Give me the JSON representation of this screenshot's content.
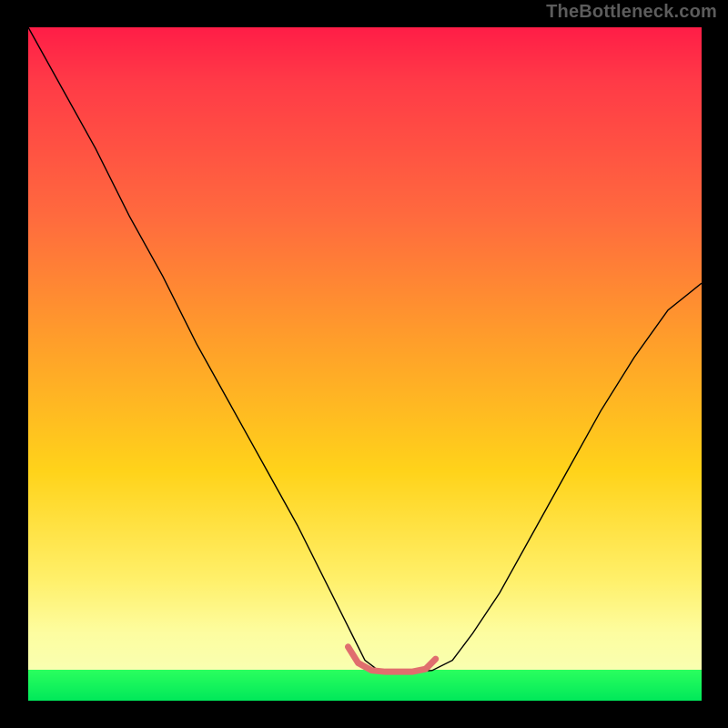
{
  "watermark": "TheBottleneck.com",
  "chart_data": {
    "type": "line",
    "title": "",
    "xlabel": "",
    "ylabel": "",
    "xlim": [
      0,
      100
    ],
    "ylim": [
      0,
      100
    ],
    "grid": false,
    "legend": false,
    "background_gradient": {
      "direction": "vertical",
      "stops": [
        {
          "pos": 0.0,
          "color": "#ff1d47"
        },
        {
          "pos": 0.28,
          "color": "#ff6a3e"
        },
        {
          "pos": 0.48,
          "color": "#ffa229"
        },
        {
          "pos": 0.66,
          "color": "#ffd31a"
        },
        {
          "pos": 0.9,
          "color": "#fdfda0"
        },
        {
          "pos": 0.955,
          "color": "#f9ffb0"
        },
        {
          "pos": 0.955,
          "color": "#2bff5e"
        },
        {
          "pos": 1.0,
          "color": "#00e85a"
        }
      ]
    },
    "series": [
      {
        "name": "bottleneck-curve",
        "color": "#000000",
        "stroke_width": 1.4,
        "x": [
          0,
          5,
          10,
          15,
          20,
          25,
          30,
          35,
          40,
          45,
          48,
          50,
          52,
          54,
          56,
          58,
          60,
          63,
          66,
          70,
          75,
          80,
          85,
          90,
          95,
          100
        ],
        "y": [
          100,
          91,
          82,
          72,
          63,
          53,
          44,
          35,
          26,
          16,
          10,
          6,
          4.5,
          4.3,
          4.3,
          4.3,
          4.5,
          6,
          10,
          16,
          25,
          34,
          43,
          51,
          58,
          62
        ]
      },
      {
        "name": "trough-highlight",
        "color": "#e06e6e",
        "stroke_width": 7,
        "linecap": "round",
        "x": [
          47.5,
          49,
          51,
          53,
          55,
          57,
          59,
          60.5
        ],
        "y": [
          8.0,
          5.6,
          4.5,
          4.3,
          4.3,
          4.3,
          4.7,
          6.2
        ]
      }
    ]
  }
}
